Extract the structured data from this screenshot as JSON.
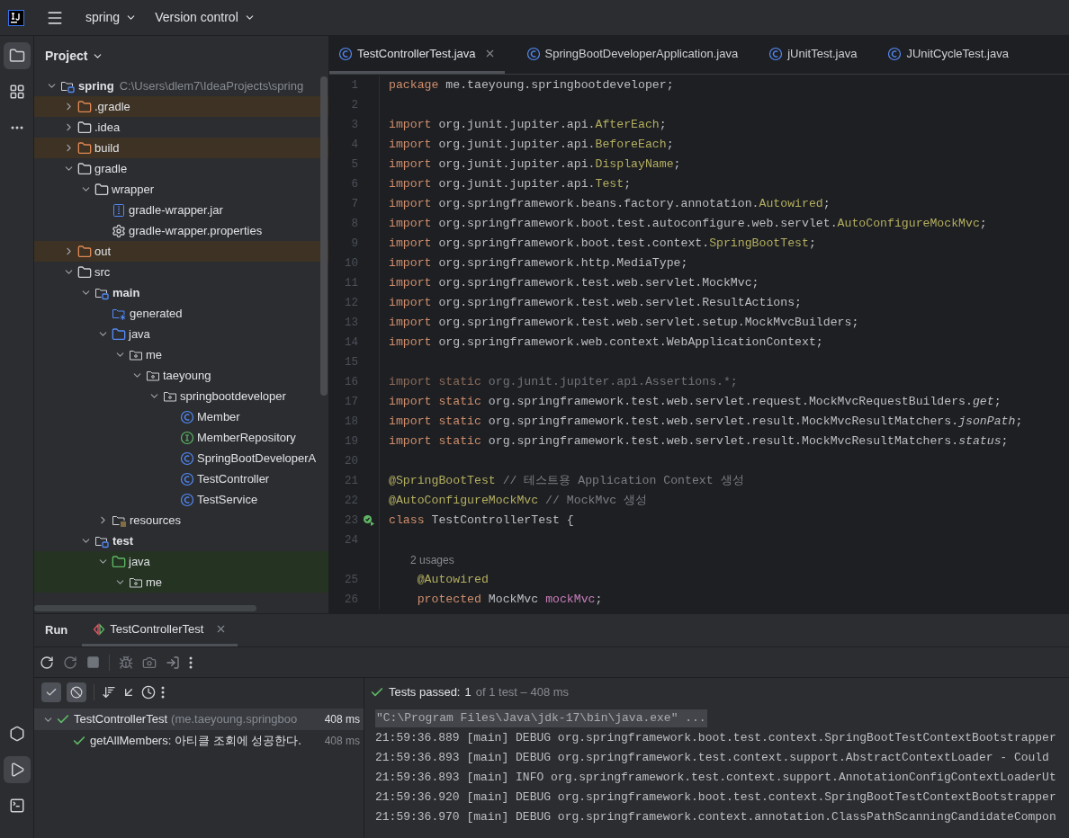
{
  "top_bar": {
    "project": "spring",
    "vcs": "Version control"
  },
  "left_strip": {
    "top": [
      {
        "kind": "project",
        "selected": true
      },
      {
        "kind": "structure",
        "selected": false
      },
      {
        "kind": "more",
        "selected": false
      }
    ],
    "bottom": [
      {
        "kind": "services",
        "selected": false
      },
      {
        "kind": "run",
        "selected": true
      },
      {
        "kind": "terminal",
        "selected": false
      }
    ]
  },
  "project_panel": {
    "title": "Project",
    "tree": [
      {
        "label": "spring",
        "kind": "module",
        "path": "C:\\Users\\dlem7\\IdeaProjects\\spring",
        "expanded": true,
        "children": [
          {
            "label": ".gradle",
            "kind": "excluded",
            "expanded": false
          },
          {
            "label": ".idea",
            "kind": "folder",
            "expanded": false
          },
          {
            "label": "build",
            "kind": "excluded",
            "expanded": false
          },
          {
            "label": "gradle",
            "kind": "folder",
            "expanded": true,
            "children": [
              {
                "label": "wrapper",
                "kind": "folder",
                "expanded": true,
                "children": [
                  {
                    "label": "gradle-wrapper.jar",
                    "kind": "jar"
                  },
                  {
                    "label": "gradle-wrapper.properties",
                    "kind": "settings"
                  }
                ]
              }
            ]
          },
          {
            "label": "out",
            "kind": "excluded",
            "expanded": false
          },
          {
            "label": "src",
            "kind": "folder",
            "expanded": true,
            "children": [
              {
                "label": "main",
                "kind": "module",
                "expanded": true,
                "children": [
                  {
                    "label": "generated",
                    "kind": "generated"
                  },
                  {
                    "label": "java",
                    "kind": "source",
                    "expanded": true,
                    "children": [
                      {
                        "label": "me",
                        "kind": "package",
                        "expanded": true,
                        "children": [
                          {
                            "label": "taeyoung",
                            "kind": "package",
                            "expanded": true,
                            "children": [
                              {
                                "label": "springbootdeveloper",
                                "kind": "package",
                                "expanded": true,
                                "children": [
                                  {
                                    "label": "Member",
                                    "kind": "class"
                                  },
                                  {
                                    "label": "MemberRepository",
                                    "kind": "interface"
                                  },
                                  {
                                    "label": "SpringBootDeveloperA",
                                    "kind": "class"
                                  },
                                  {
                                    "label": "TestController",
                                    "kind": "class"
                                  },
                                  {
                                    "label": "TestService",
                                    "kind": "class"
                                  }
                                ]
                              }
                            ]
                          }
                        ]
                      }
                    ]
                  },
                  {
                    "label": "resources",
                    "kind": "resources",
                    "expanded": false
                  }
                ]
              },
              {
                "label": "test",
                "kind": "module",
                "expanded": true,
                "children": [
                  {
                    "label": "java",
                    "kind": "test-source",
                    "expanded": true,
                    "children": [
                      {
                        "label": "me",
                        "kind": "package",
                        "expanded": true
                      }
                    ]
                  }
                ]
              }
            ]
          }
        ]
      }
    ]
  },
  "editor": {
    "tabs": [
      {
        "label": "TestControllerTest.java",
        "selected": true
      },
      {
        "label": "SpringBootDeveloperApplication.java",
        "selected": false
      },
      {
        "label": "jUnitTest.java",
        "selected": false
      },
      {
        "label": "JUnitCycleTest.java",
        "selected": false
      }
    ],
    "lines": [
      {
        "kind": "code",
        "number": "1",
        "tokens": [
          {
            "kind": "kw",
            "text": "package"
          },
          {
            "kind": "plain",
            "text": " me.taeyoung.springbootdeveloper;"
          }
        ]
      },
      {
        "kind": "code",
        "number": "2"
      },
      {
        "kind": "code",
        "number": "3",
        "tokens": [
          {
            "kind": "kw",
            "text": "import"
          },
          {
            "kind": "plain",
            "text": " org.junit.jupiter.api."
          },
          {
            "kind": "ann",
            "text": "AfterEach"
          },
          {
            "kind": "plain",
            "text": ";"
          }
        ]
      },
      {
        "kind": "code",
        "number": "4",
        "tokens": [
          {
            "kind": "kw",
            "text": "import"
          },
          {
            "kind": "plain",
            "text": " org.junit.jupiter.api."
          },
          {
            "kind": "ann",
            "text": "BeforeEach"
          },
          {
            "kind": "plain",
            "text": ";"
          }
        ]
      },
      {
        "kind": "code",
        "number": "5",
        "tokens": [
          {
            "kind": "kw",
            "text": "import"
          },
          {
            "kind": "plain",
            "text": " org.junit.jupiter.api."
          },
          {
            "kind": "ann",
            "text": "DisplayName"
          },
          {
            "kind": "plain",
            "text": ";"
          }
        ]
      },
      {
        "kind": "code",
        "number": "6",
        "tokens": [
          {
            "kind": "kw",
            "text": "import"
          },
          {
            "kind": "plain",
            "text": " org.junit.jupiter.api."
          },
          {
            "kind": "ann",
            "text": "Test"
          },
          {
            "kind": "plain",
            "text": ";"
          }
        ]
      },
      {
        "kind": "code",
        "number": "7",
        "tokens": [
          {
            "kind": "kw",
            "text": "import"
          },
          {
            "kind": "plain",
            "text": " org.springframework.beans.factory.annotation."
          },
          {
            "kind": "ann",
            "text": "Autowired"
          },
          {
            "kind": "plain",
            "text": ";"
          }
        ]
      },
      {
        "kind": "code",
        "number": "8",
        "tokens": [
          {
            "kind": "kw",
            "text": "import"
          },
          {
            "kind": "plain",
            "text": " org.springframework.boot.test.autoconfigure.web.servlet."
          },
          {
            "kind": "ann",
            "text": "AutoConfigureMockMvc"
          },
          {
            "kind": "plain",
            "text": ";"
          }
        ]
      },
      {
        "kind": "code",
        "number": "9",
        "tokens": [
          {
            "kind": "kw",
            "text": "import"
          },
          {
            "kind": "plain",
            "text": " org.springframework.boot.test.context."
          },
          {
            "kind": "ann",
            "text": "SpringBootTest"
          },
          {
            "kind": "plain",
            "text": ";"
          }
        ]
      },
      {
        "kind": "code",
        "number": "10",
        "tokens": [
          {
            "kind": "kw",
            "text": "import"
          },
          {
            "kind": "plain",
            "text": " org.springframework.http.MediaType;"
          }
        ]
      },
      {
        "kind": "code",
        "number": "11",
        "tokens": [
          {
            "kind": "kw",
            "text": "import"
          },
          {
            "kind": "plain",
            "text": " org.springframework.test.web.servlet.MockMvc;"
          }
        ]
      },
      {
        "kind": "code",
        "number": "12",
        "tokens": [
          {
            "kind": "kw",
            "text": "import"
          },
          {
            "kind": "plain",
            "text": " org.springframework.test.web.servlet.ResultActions;"
          }
        ]
      },
      {
        "kind": "code",
        "number": "13",
        "tokens": [
          {
            "kind": "kw",
            "text": "import"
          },
          {
            "kind": "plain",
            "text": " org.springframework.test.web.servlet.setup.MockMvcBuilders;"
          }
        ]
      },
      {
        "kind": "code",
        "number": "14",
        "tokens": [
          {
            "kind": "kw",
            "text": "import"
          },
          {
            "kind": "plain",
            "text": " org.springframework.web.context.WebApplicationContext;"
          }
        ]
      },
      {
        "kind": "code",
        "number": "15"
      },
      {
        "kind": "code",
        "number": "16",
        "tokens": [
          {
            "kind": "unused-kw",
            "text": "import static"
          },
          {
            "kind": "unused",
            "text": " org.junit.jupiter.api.Assertions.*;"
          }
        ]
      },
      {
        "kind": "code",
        "number": "17",
        "tokens": [
          {
            "kind": "kw",
            "text": "import static"
          },
          {
            "kind": "plain",
            "text": " org.springframework.test.web.servlet.request.MockMvcRequestBuilders."
          },
          {
            "kind": "italic",
            "text": "get"
          },
          {
            "kind": "plain",
            "text": ";"
          }
        ]
      },
      {
        "kind": "code",
        "number": "18",
        "tokens": [
          {
            "kind": "kw",
            "text": "import static"
          },
          {
            "kind": "plain",
            "text": " org.springframework.test.web.servlet.result.MockMvcResultMatchers."
          },
          {
            "kind": "italic",
            "text": "jsonPath"
          },
          {
            "kind": "plain",
            "text": ";"
          }
        ]
      },
      {
        "kind": "code",
        "number": "19",
        "tokens": [
          {
            "kind": "kw",
            "text": "import static"
          },
          {
            "kind": "plain",
            "text": " org.springframework.test.web.servlet.result.MockMvcResultMatchers."
          },
          {
            "kind": "italic",
            "text": "status"
          },
          {
            "kind": "plain",
            "text": ";"
          }
        ]
      },
      {
        "kind": "code",
        "number": "20"
      },
      {
        "kind": "code",
        "number": "21",
        "tokens": [
          {
            "kind": "ann",
            "text": "@SpringBootTest"
          },
          {
            "kind": "comment",
            "text": " // 테스트용 Application Context 생성"
          }
        ]
      },
      {
        "kind": "code",
        "number": "22",
        "tokens": [
          {
            "kind": "ann",
            "text": "@AutoConfigureMockMvc"
          },
          {
            "kind": "comment",
            "text": " // MockMvc 생성"
          }
        ]
      },
      {
        "kind": "code",
        "number": "23",
        "run_marker": true,
        "tokens": [
          {
            "kind": "kw",
            "text": "class"
          },
          {
            "kind": "plain",
            "text": " TestControllerTest {"
          }
        ]
      },
      {
        "kind": "code",
        "number": "24"
      },
      {
        "kind": "inlay",
        "text": "2 usages"
      },
      {
        "kind": "code",
        "number": "25",
        "tokens": [
          {
            "kind": "ann",
            "text": "    @Autowired"
          }
        ]
      },
      {
        "kind": "code",
        "number": "26",
        "tokens": [
          {
            "kind": "kw",
            "text": "    protected"
          },
          {
            "kind": "plain",
            "text": " MockMvc "
          },
          {
            "kind": "field",
            "text": "mockMvc"
          },
          {
            "kind": "plain",
            "text": ";"
          }
        ]
      }
    ]
  },
  "run_panel": {
    "title": "Run",
    "tabs": [
      {
        "label": "TestControllerTest",
        "selected": true
      }
    ],
    "filters": [
      {
        "kind": "passed",
        "checked": true
      },
      {
        "kind": "ignored",
        "checked": true
      }
    ],
    "summary": {
      "label": "Tests passed:",
      "count": "1",
      "detail": "of 1 test – 408 ms"
    },
    "tests": [
      {
        "name": "TestControllerTest",
        "package": "(me.taeyoung.springboo",
        "time": "408 ms",
        "passed": true,
        "selected": true,
        "expanded": true,
        "children": [
          {
            "name": "getAllMembers: 아티클 조회에 성공한다.",
            "time": "408 ms",
            "passed": true,
            "selected": false
          }
        ]
      }
    ],
    "console": [
      {
        "kind": "command",
        "text": "\"C:\\Program Files\\Java\\jdk-17\\bin\\java.exe\" ..."
      },
      {
        "kind": "log",
        "text": "21:59:36.889 [main] DEBUG org.springframework.boot.test.context.SpringBootTestContextBootstrapper"
      },
      {
        "kind": "log",
        "text": "21:59:36.893 [main] DEBUG org.springframework.test.context.support.AbstractContextLoader - Could"
      },
      {
        "kind": "log",
        "text": "21:59:36.893 [main] INFO org.springframework.test.context.support.AnnotationConfigContextLoaderUt"
      },
      {
        "kind": "log",
        "text": "21:59:36.920 [main] DEBUG org.springframework.boot.test.context.SpringBootTestContextBootstrapper"
      },
      {
        "kind": "log",
        "text": "21:59:36.970 [main] DEBUG org.springframework.context.annotation.ClassPathScanningCandidateCompon"
      }
    ]
  }
}
